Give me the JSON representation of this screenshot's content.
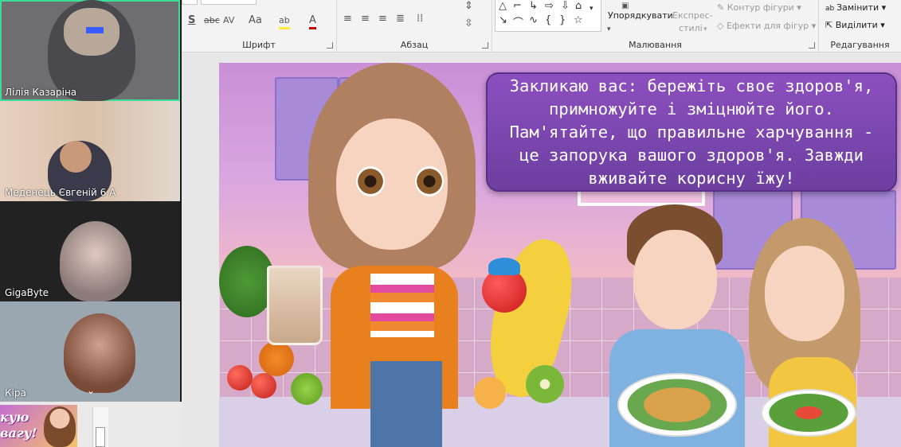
{
  "ribbon": {
    "groups": {
      "font": "Шрифт",
      "paragraph": "Абзац",
      "drawing": "Малювання",
      "editing": "Редагування"
    },
    "font_controls": {
      "shadow": "S",
      "strike": "abc",
      "spacing": "AV",
      "case": "Aa",
      "highlight": "ab",
      "color": "A"
    },
    "arrange": "Упорядкувати",
    "quick_styles_1": "Експрес-",
    "quick_styles_2": "стилі",
    "shape_outline": "Контур фігури",
    "shape_effects": "Ефекти для фігур",
    "replace": "Замінити",
    "select": "Виділити"
  },
  "slide": {
    "speech": "Закликаю вас: бережіть своє здоров'я, примножуйте і зміцнюйте його. Пам'ятайте, що правильне харчування - це запорука вашого здоров'я. Завжди вживайте корисну їжу!"
  },
  "participants": [
    {
      "name": "Лілія Казаріна",
      "active": true
    },
    {
      "name": "Меденець Євгеній 6 А",
      "active": false
    },
    {
      "name": "GigaByte",
      "active": false
    },
    {
      "name": "Кіра",
      "active": false
    }
  ],
  "thumbnail": {
    "line1": "кую",
    "line2": "вагу!"
  }
}
